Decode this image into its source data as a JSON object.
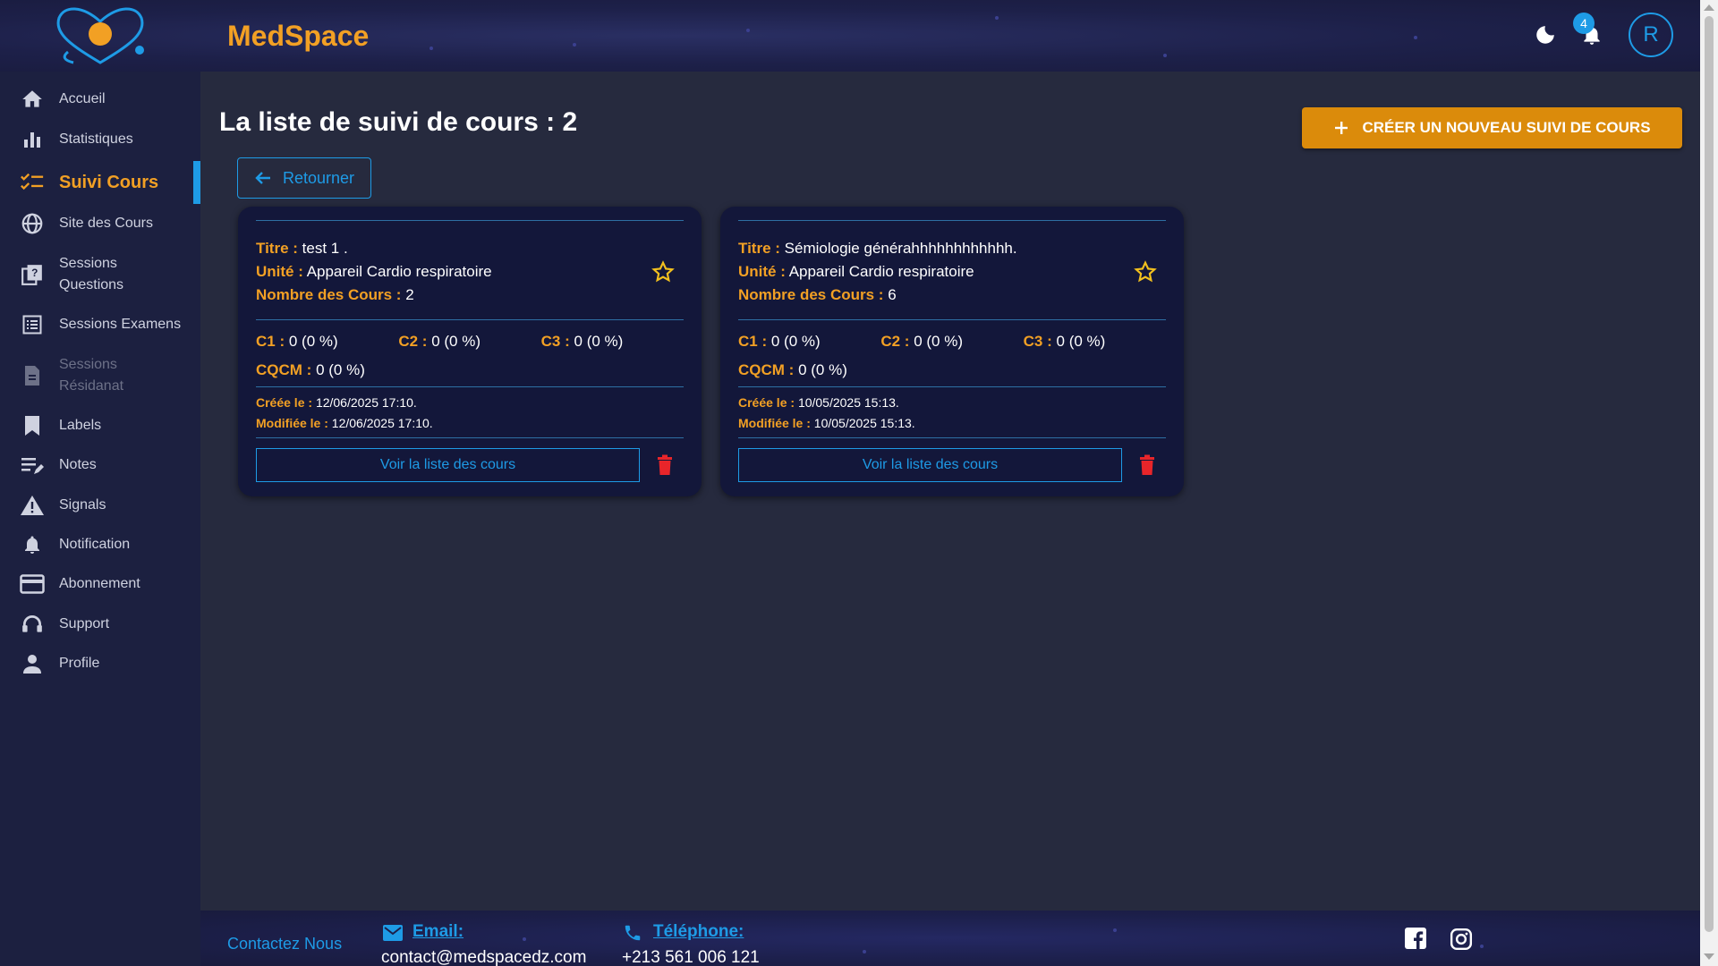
{
  "header": {
    "brand": "MedSpace",
    "notification_count": "4",
    "avatar_initial": "R"
  },
  "sidebar": {
    "items": [
      {
        "label": "Accueil",
        "icon": "home-icon"
      },
      {
        "label": "Statistiques",
        "icon": "bar-chart-icon"
      },
      {
        "label": "Suivi Cours",
        "icon": "checklist-icon",
        "active": true
      },
      {
        "label": "Site des Cours",
        "icon": "globe-icon"
      },
      {
        "label": "Sessions Questions",
        "icon": "quiz-icon"
      },
      {
        "label": "Sessions Examens",
        "icon": "list-icon"
      },
      {
        "label": "Sessions Résidanat",
        "icon": "document-icon",
        "disabled": true
      },
      {
        "label": "Labels",
        "icon": "bookmark-icon"
      },
      {
        "label": "Notes",
        "icon": "notes-icon"
      },
      {
        "label": "Signals",
        "icon": "warning-icon"
      },
      {
        "label": "Notification",
        "icon": "bell-icon"
      },
      {
        "label": "Abonnement",
        "icon": "credit-card-icon"
      },
      {
        "label": "Support",
        "icon": "headset-icon"
      },
      {
        "label": "Profile",
        "icon": "person-icon"
      }
    ]
  },
  "main": {
    "title": "La liste de suivi de cours : 2",
    "create_label": "CRÉER UN NOUVEAU SUIVI DE COURS",
    "back_label": "Retourner",
    "labels": {
      "titre": "Titre :",
      "unite": "Unité :",
      "nombre": "Nombre des Cours :",
      "c1": "C1 :",
      "c2": "C2 :",
      "c3": "C3 :",
      "cqcm": "CQCM :",
      "creee": "Créée le :",
      "modifiee": "Modifiée le :",
      "voir": "Voir la liste des cours"
    },
    "cards": [
      {
        "titre": "test 1 .",
        "unite": "Appareil Cardio respiratoire",
        "nombre": "2",
        "c1": "0 (0 %)",
        "c2": "0 (0 %)",
        "c3": "0 (0 %)",
        "cqcm": "0 (0 %)",
        "creee": "12/06/2025 17:10.",
        "modifiee": "12/06/2025 17:10."
      },
      {
        "titre": "Sémiologie générahhhhhhhhhhhh.",
        "unite": "Appareil Cardio respiratoire",
        "nombre": "6",
        "c1": "0 (0 %)",
        "c2": "0 (0 %)",
        "c3": "0 (0 %)",
        "cqcm": "0 (0 %)",
        "creee": "10/05/2025 15:13.",
        "modifiee": "10/05/2025 15:13."
      }
    ]
  },
  "footer": {
    "contact": "Contactez Nous",
    "email_label": "Email:",
    "email_value": "contact@medspacedz.com",
    "phone_label": "Téléphone:",
    "phone_value": "+213 561 006 121"
  },
  "colors": {
    "accent_orange": "#f2a024",
    "accent_blue": "#1e9be6",
    "sidebar_bg": "#1c2040",
    "main_bg": "#262a3e",
    "card_bg": "#13173a"
  }
}
